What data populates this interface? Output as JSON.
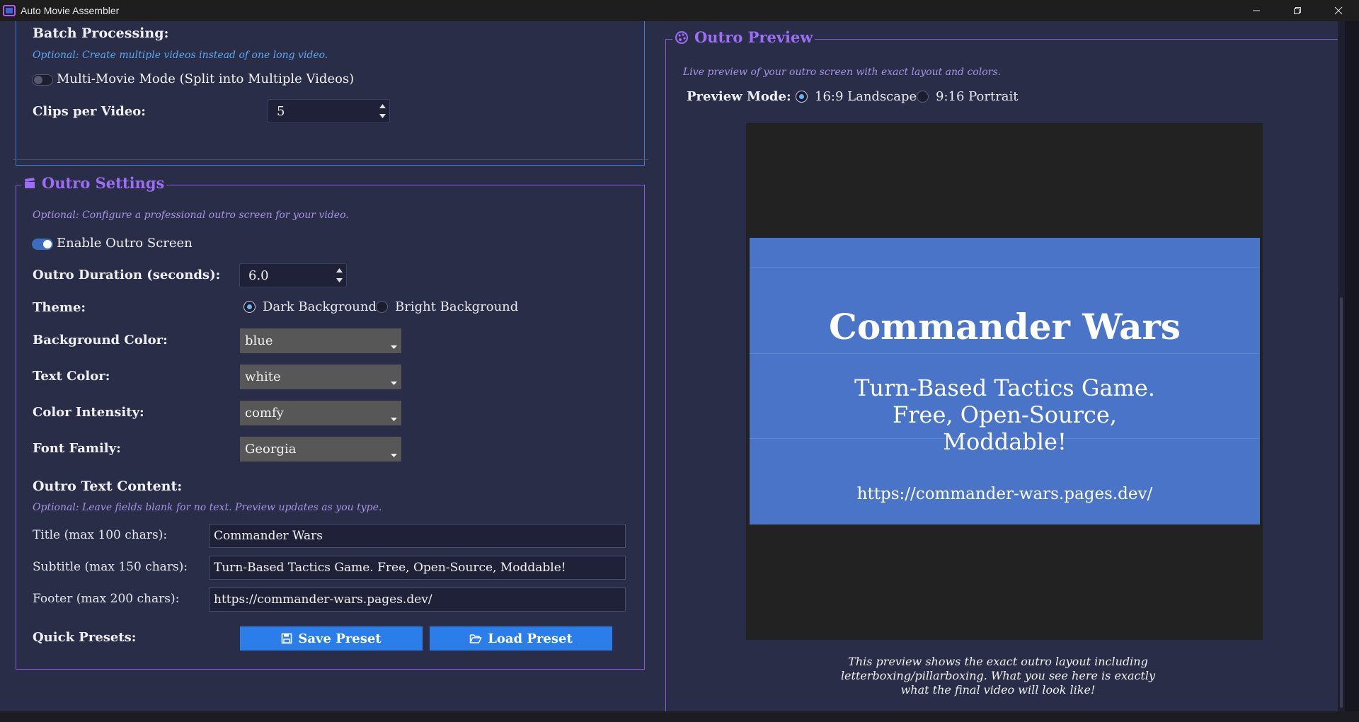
{
  "window": {
    "title": "Auto Movie Assembler"
  },
  "batch": {
    "heading": "Batch Processing:",
    "hint": "Optional: Create multiple videos instead of one long video.",
    "multi_movie_label": "Multi-Movie Mode (Split into Multiple Videos)",
    "multi_movie_enabled": false,
    "clips_label": "Clips per Video:",
    "clips_value": "5"
  },
  "outro": {
    "group_title": "Outro Settings",
    "hint": "Optional: Configure a professional outro screen for your video.",
    "enable_label": "Enable Outro Screen",
    "enabled": true,
    "duration_label": "Outro Duration (seconds):",
    "duration_value": "6.0",
    "theme_label": "Theme:",
    "theme_options": [
      "Dark Background",
      "Bright Background"
    ],
    "theme_selected": "Dark Background",
    "bg_color_label": "Background Color:",
    "bg_color_value": "blue",
    "text_color_label": "Text Color:",
    "text_color_value": "white",
    "intensity_label": "Color Intensity:",
    "intensity_value": "comfy",
    "font_label": "Font Family:",
    "font_value": "Georgia",
    "content_heading": "Outro Text Content:",
    "content_hint": "Optional: Leave fields blank for no text. Preview updates as you type.",
    "title_label": "Title (max 100 chars):",
    "title_value": "Commander Wars",
    "subtitle_label": "Subtitle (max 150 chars):",
    "subtitle_value": "Turn-Based Tactics Game. Free, Open-Source, Moddable!",
    "footer_label": "Footer (max 200 chars):",
    "footer_value": "https://commander-wars.pages.dev/",
    "presets_label": "Quick Presets:",
    "save_preset": "Save Preset",
    "load_preset": "Load Preset"
  },
  "preview": {
    "group_title": "Outro Preview",
    "hint": "Live preview of your outro screen with exact layout and colors.",
    "mode_label": "Preview Mode:",
    "mode_options": [
      "16:9 Landscape",
      "9:16 Portrait"
    ],
    "mode_selected": "16:9 Landscape",
    "card_title": "Commander Wars",
    "card_subtitle": "Turn-Based Tactics Game. Free, Open-Source, Moddable!",
    "card_footer": "https://commander-wars.pages.dev/",
    "card_color": "#4a74c8",
    "note": "This preview shows the exact outro layout including letterboxing/pillarboxing. What you see here is exactly what the final video will look like!"
  },
  "colors": {
    "accent_purple": "#9b6ef5",
    "accent_blue": "#2b7de9",
    "panel_bg": "#2a2d48"
  }
}
